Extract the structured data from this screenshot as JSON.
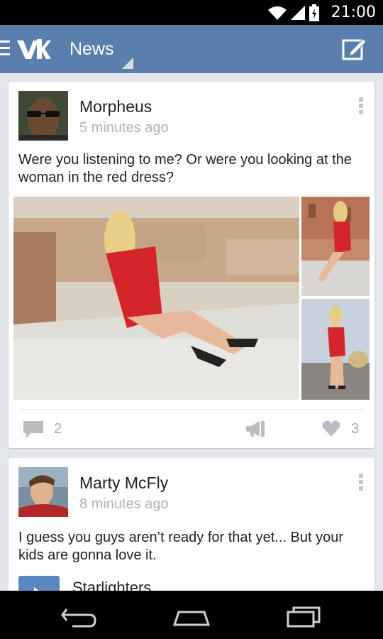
{
  "status_bar": {
    "time": "21:00"
  },
  "app_bar": {
    "title": "News"
  },
  "posts": [
    {
      "author": "Morpheus",
      "time_ago": "5 minutes ago",
      "text": "Were you listening to me? Or were you looking at the woman in the red dress?",
      "comments_count": "2",
      "likes_count": "3"
    },
    {
      "author": "Marty McFly",
      "time_ago": "8 minutes ago",
      "text": "I guess you guys aren’t ready for that yet... But your kids are gonna love it.",
      "audio_title": "Starlighters"
    }
  ],
  "colors": {
    "app_bar": "#5b7fad",
    "accent": "#5b87c0",
    "background": "#e3e6ea"
  },
  "icons": [
    "menu-icon",
    "vk-logo",
    "dropdown-triangle-icon",
    "compose-icon",
    "more-vert-icon",
    "comment-icon",
    "share-icon",
    "heart-icon",
    "play-icon",
    "back-icon",
    "home-icon",
    "recent-apps-icon",
    "wifi-icon",
    "signal-icon",
    "battery-icon"
  ]
}
